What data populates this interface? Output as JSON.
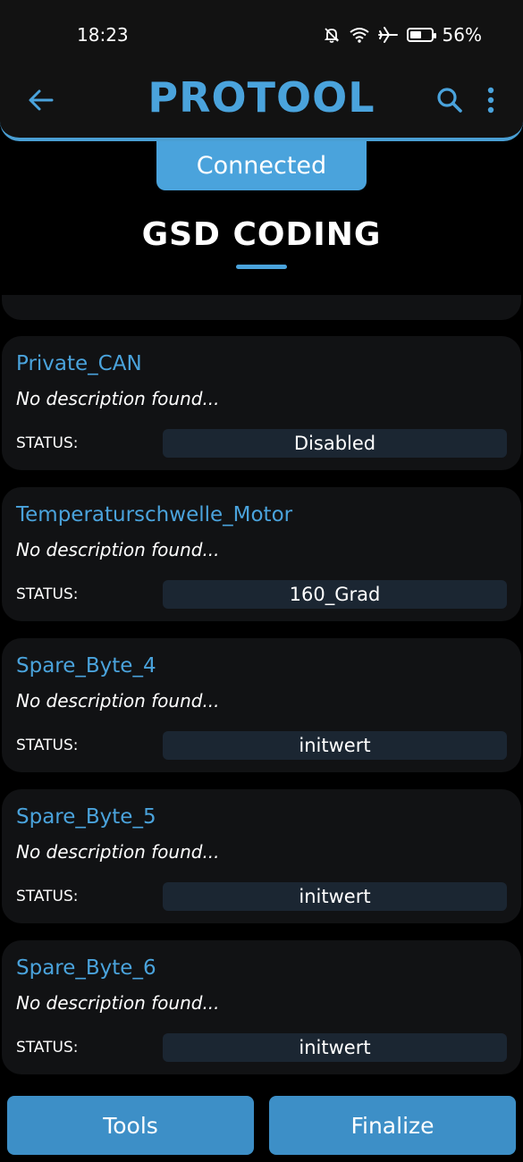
{
  "status_bar": {
    "time": "18:23",
    "battery_percent_text": "56%",
    "battery_level": 0.56,
    "icons": [
      "mute-icon",
      "wifi-icon",
      "airplane-icon",
      "battery-icon"
    ]
  },
  "app_bar": {
    "title": "PROTOOL",
    "back_icon": "arrow-left-icon",
    "search_icon": "search-icon",
    "menu_icon": "more-vertical-icon"
  },
  "connection": {
    "label": "Connected"
  },
  "page": {
    "title": "GSD CODING"
  },
  "cards": [
    {
      "name": "Private_CAN",
      "description": "No description found...",
      "status_label": "STATUS:",
      "status_value": "Disabled"
    },
    {
      "name": "Temperaturschwelle_Motor",
      "description": "No description found...",
      "status_label": "STATUS:",
      "status_value": "160_Grad"
    },
    {
      "name": "Spare_Byte_4",
      "description": "No description found...",
      "status_label": "STATUS:",
      "status_value": "initwert"
    },
    {
      "name": "Spare_Byte_5",
      "description": "No description found...",
      "status_label": "STATUS:",
      "status_value": "initwert"
    },
    {
      "name": "Spare_Byte_6",
      "description": "No description found...",
      "status_label": "STATUS:",
      "status_value": "initwert"
    }
  ],
  "buttons": {
    "tools": "Tools",
    "finalize": "Finalize"
  },
  "colors": {
    "accent": "#4aa3dc",
    "button": "#3d8fc7",
    "card_bg": "#111214",
    "status_pill": "#1b2632",
    "background": "#000000"
  }
}
